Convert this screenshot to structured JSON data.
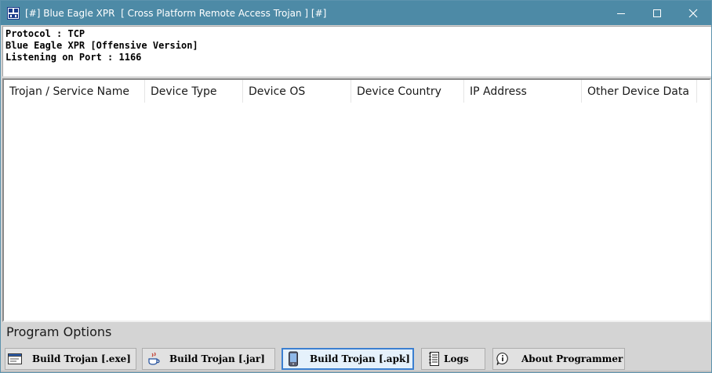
{
  "window": {
    "title": "[#] Blue Eagle XPR  [ Cross Platform Remote Access Trojan ] [#]",
    "minimize_glyph": "—",
    "maximize_glyph": "☐",
    "close_glyph": "✕"
  },
  "status": {
    "protocol": "Protocol : TCP",
    "version": "Blue Eagle XPR [Offensive Version]",
    "listening": "Listening on Port : 1166"
  },
  "table": {
    "columns": [
      "Trojan / Service Name",
      "Device Type",
      "Device OS",
      "Device Country",
      "IP Address",
      "Other Device Data"
    ],
    "rows": []
  },
  "options": {
    "label": "Program Options",
    "buttons": [
      {
        "label": "Build Trojan [.exe]",
        "icon": "window-icon"
      },
      {
        "label": "Build Trojan [.jar]",
        "icon": "java-cup-icon"
      },
      {
        "label": "Build Trojan [.apk]",
        "icon": "phone-icon"
      },
      {
        "label": "Logs",
        "icon": "notepad-icon"
      },
      {
        "label": "About Programmer",
        "icon": "info-icon"
      }
    ]
  },
  "colors": {
    "titlebar": "#4d8aa6",
    "panel": "#d4d4d4",
    "button_focus_border": "#3b7fd0"
  }
}
